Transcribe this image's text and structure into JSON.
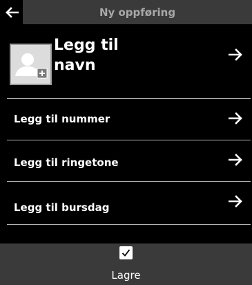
{
  "header": {
    "back_icon": "arrow-left-icon",
    "title": "Ny oppføring"
  },
  "contact": {
    "avatar_icon": "person-add-icon",
    "name_label": "Legg til navn",
    "arrow_icon": "arrow-right-icon"
  },
  "items": [
    {
      "label": "Legg til nummer",
      "icon": "arrow-right-icon"
    },
    {
      "label": "Legg til ringetone",
      "icon": "arrow-right-icon"
    },
    {
      "label": "Legg til bursdag",
      "icon": "arrow-right-icon"
    }
  ],
  "footer": {
    "check_icon": "checkmark-icon",
    "save_label": "Lagre"
  },
  "colors": {
    "background": "#000000",
    "bar": "#3a3a3a",
    "title_text": "#a8a8a8",
    "divider": "#b5b5b5"
  }
}
